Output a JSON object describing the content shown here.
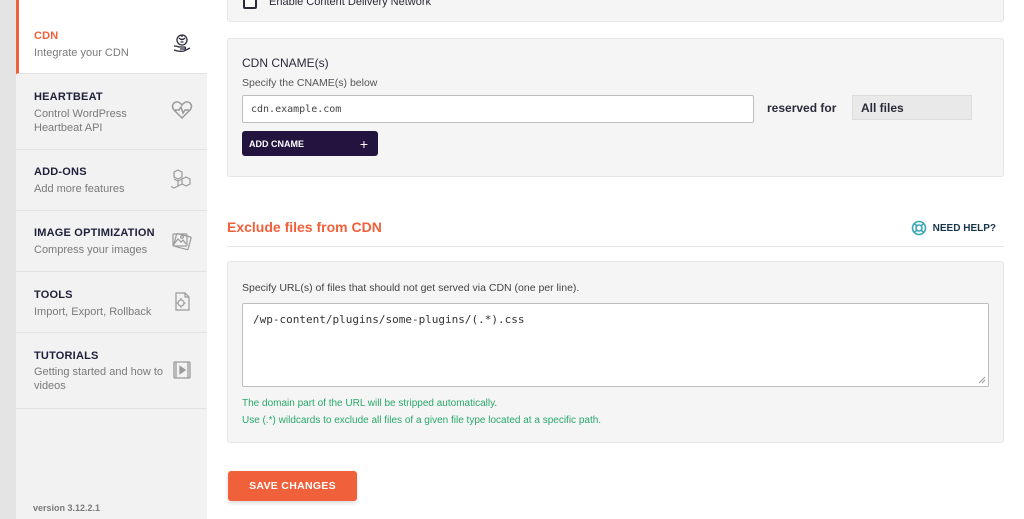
{
  "sidebar": {
    "items": [
      {
        "title": "CDN",
        "subtitle": "Integrate your CDN",
        "icon": "cdn-icon"
      },
      {
        "title": "HEARTBEAT",
        "subtitle": "Control WordPress Heartbeat API",
        "icon": "heartbeat-icon"
      },
      {
        "title": "ADD-ONS",
        "subtitle": "Add more features",
        "icon": "addons-icon"
      },
      {
        "title": "IMAGE OPTIMIZATION",
        "subtitle": "Compress your images",
        "icon": "image-icon"
      },
      {
        "title": "TOOLS",
        "subtitle": "Import, Export, Rollback",
        "icon": "tools-icon"
      },
      {
        "title": "TUTORIALS",
        "subtitle": "Getting started and how to videos",
        "icon": "video-icon"
      }
    ],
    "version": "version 3.12.2.1"
  },
  "cdn_panel": {
    "enable_label": "Enable Content Delivery Network",
    "cname_title": "CDN CNAME(s)",
    "cname_desc": "Specify the CNAME(s) below",
    "cname_placeholder": "cdn.example.com",
    "reserved_label": "reserved for",
    "reserved_value": "All files",
    "add_button": "ADD CNAME",
    "add_symbol": "+"
  },
  "exclude": {
    "title": "Exclude files from CDN",
    "help_label": "NEED HELP?",
    "desc": "Specify URL(s) of files that should not get served via CDN (one per line).",
    "value": "/wp-content/plugins/some-plugins/(.*).css",
    "hint1": "The domain part of the URL will be stripped automatically.",
    "hint2": "Use (.*) wildcards to exclude all files of a given file type located at a specific path."
  },
  "save_button": "SAVE CHANGES",
  "colors": {
    "accent": "#f0603a",
    "dark_button": "#23133f",
    "hint_green": "#29a86b",
    "help_teal": "#3aa7b4"
  }
}
